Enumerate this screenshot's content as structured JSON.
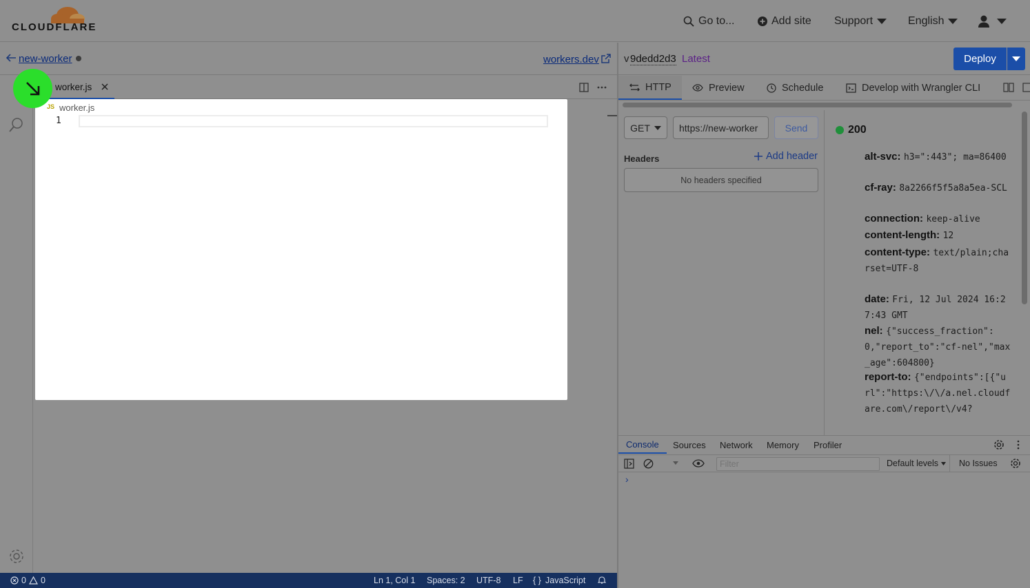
{
  "brand": {
    "name": "CLOUDFLARE"
  },
  "topnav": {
    "goto": "Go to...",
    "add_site": "Add site",
    "support": "Support",
    "language": "English"
  },
  "worker": {
    "name": "new-worker",
    "domain_link": "workers.dev"
  },
  "editor": {
    "tab_label": "worker.js",
    "breadcrumb_icon": "JS",
    "breadcrumb": "worker.js",
    "line_numbers": [
      "1"
    ]
  },
  "status": {
    "errors": "0",
    "warnings": "0",
    "position": "Ln 1, Col 1",
    "spaces": "Spaces: 2",
    "encoding": "UTF-8",
    "eol": "LF",
    "language": "JavaScript"
  },
  "version": {
    "prefix": "v",
    "id": "9dedd2d3",
    "badge": "Latest"
  },
  "deploy": {
    "label": "Deploy"
  },
  "right_tabs": {
    "http": "HTTP",
    "preview": "Preview",
    "schedule": "Schedule",
    "wrangler": "Develop with Wrangler CLI"
  },
  "request": {
    "method": "GET",
    "url": "https://new-worker",
    "send": "Send",
    "headers_title": "Headers",
    "add_header": "Add header",
    "no_headers": "No headers specified"
  },
  "response": {
    "status_code": "200",
    "headers": [
      {
        "key": "alt-svc:",
        "value": "h3=\":443\"; ma=86400"
      },
      {
        "key": "cf-ray:",
        "value": "8a2266f5f5a8a5ea-SCL"
      },
      {
        "key": "connection:",
        "value": "keep-alive"
      },
      {
        "key": "content-length:",
        "value": "12"
      },
      {
        "key": "content-type:",
        "value": "text/plain;charset=UTF-8"
      },
      {
        "key": "date:",
        "value": "Fri, 12 Jul 2024 16:27:43 GMT"
      },
      {
        "key": "nel:",
        "value": "{\"success_fraction\":0,\"report_to\":\"cf-nel\",\"max_age\":604800}"
      },
      {
        "key": "report-to:",
        "value": "{\"endpoints\":[{\"url\":\"https:\\/\\/a.nel.cloudfare.com\\/report\\/v4?"
      }
    ]
  },
  "devtools": {
    "tabs": [
      "Console",
      "Sources",
      "Network",
      "Memory",
      "Profiler"
    ],
    "filter_placeholder": "Filter",
    "levels": "Default levels",
    "issues": "No Issues",
    "prompt": "›"
  },
  "colors": {
    "accent": "#1b4ea8",
    "status_bar": "#16305f",
    "cursor": "#2bde2b",
    "status_ok": "#1f8f3a",
    "version_badge": "#5a1f86"
  }
}
